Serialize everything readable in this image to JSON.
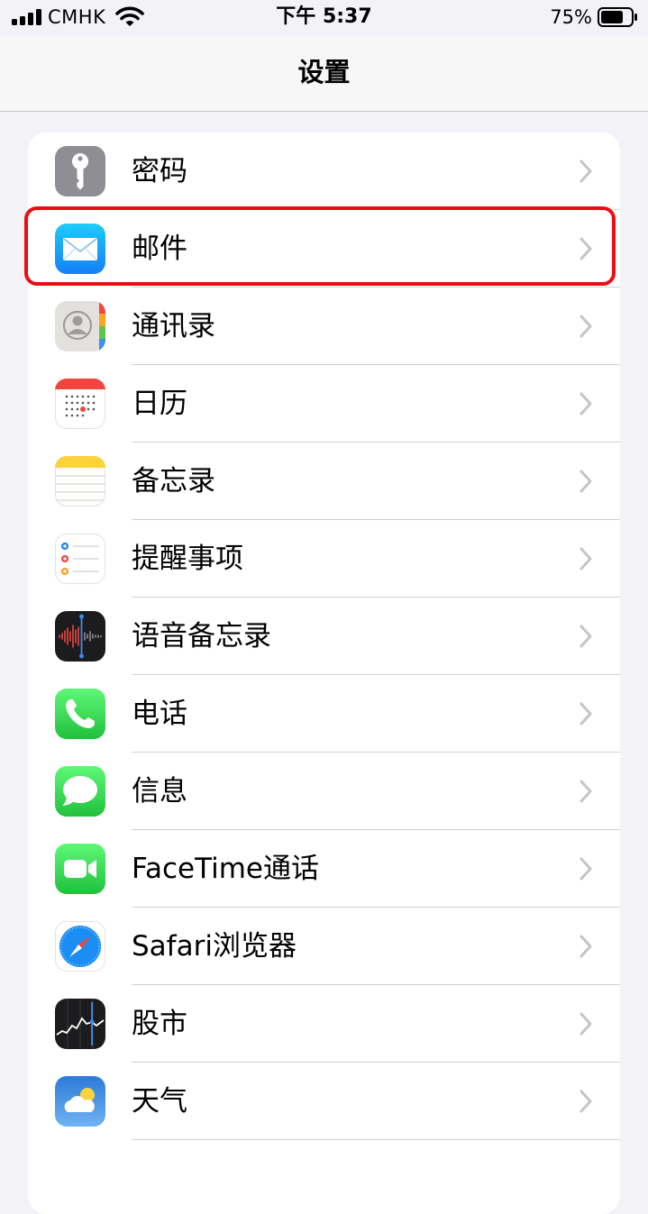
{
  "status_bar": {
    "carrier": "CMHK",
    "time": "下午 5:37",
    "battery_percent": "75%",
    "battery_level": 0.75
  },
  "nav": {
    "title": "设置"
  },
  "settings_items": [
    {
      "label": "密码",
      "icon": "key-icon"
    },
    {
      "label": "邮件",
      "icon": "mail-icon"
    },
    {
      "label": "通讯录",
      "icon": "contacts-icon"
    },
    {
      "label": "日历",
      "icon": "calendar-icon"
    },
    {
      "label": "备忘录",
      "icon": "notes-icon"
    },
    {
      "label": "提醒事项",
      "icon": "reminders-icon"
    },
    {
      "label": "语音备忘录",
      "icon": "voice-memos-icon"
    },
    {
      "label": "电话",
      "icon": "phone-icon"
    },
    {
      "label": "信息",
      "icon": "messages-icon"
    },
    {
      "label": "FaceTime通话",
      "icon": "facetime-icon"
    },
    {
      "label": "Safari浏览器",
      "icon": "safari-icon"
    },
    {
      "label": "股市",
      "icon": "stocks-icon"
    },
    {
      "label": "天气",
      "icon": "weather-icon"
    }
  ],
  "colors": {
    "highlight": "#ef0b14",
    "background": "#f2f2f7",
    "chevron": "#c4c4c7"
  }
}
